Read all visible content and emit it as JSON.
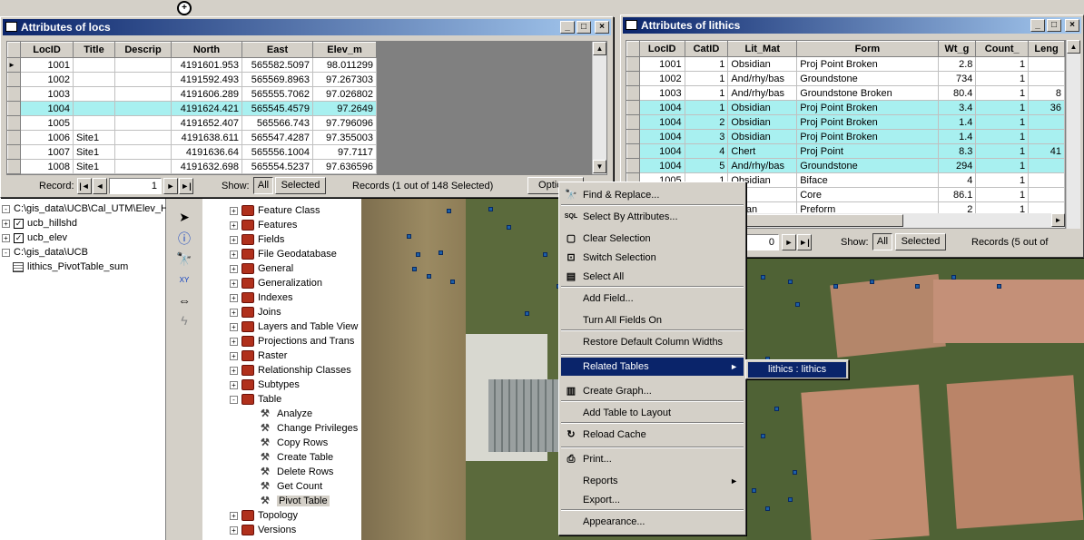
{
  "locs_window": {
    "title": "Attributes of locs",
    "columns": [
      "LocID",
      "Title",
      "Descrip",
      "North",
      "East",
      "Elev_m"
    ],
    "rows": [
      {
        "LocID": "1001",
        "Title": "",
        "Descrip": "",
        "North": "4191601.953",
        "East": "565582.5097",
        "Elev_m": "98.011299",
        "hl": false
      },
      {
        "LocID": "1002",
        "Title": "",
        "Descrip": "",
        "North": "4191592.493",
        "East": "565569.8963",
        "Elev_m": "97.267303",
        "hl": false
      },
      {
        "LocID": "1003",
        "Title": "",
        "Descrip": "",
        "North": "4191606.289",
        "East": "565555.7062",
        "Elev_m": "97.026802",
        "hl": false
      },
      {
        "LocID": "1004",
        "Title": "",
        "Descrip": "",
        "North": "4191624.421",
        "East": "565545.4579",
        "Elev_m": "97.2649",
        "hl": true
      },
      {
        "LocID": "1005",
        "Title": "",
        "Descrip": "",
        "North": "4191652.407",
        "East": "565566.743",
        "Elev_m": "97.796096",
        "hl": false
      },
      {
        "LocID": "1006",
        "Title": "Site1",
        "Descrip": "",
        "North": "4191638.611",
        "East": "565547.4287",
        "Elev_m": "97.355003",
        "hl": false
      },
      {
        "LocID": "1007",
        "Title": "Site1",
        "Descrip": "",
        "North": "4191636.64",
        "East": "565556.1004",
        "Elev_m": "97.7117",
        "hl": false
      },
      {
        "LocID": "1008",
        "Title": "Site1",
        "Descrip": "",
        "North": "4191632.698",
        "East": "565554.5237",
        "Elev_m": "97.636596",
        "hl": false
      }
    ],
    "record_label": "Record:",
    "record_value": "1",
    "show_label": "Show:",
    "show_all": "All",
    "show_selected": "Selected",
    "records_status": "Records (1 out of 148 Selected)",
    "options_label": "Options"
  },
  "lithics_window": {
    "title": "Attributes of lithics",
    "columns": [
      "LocID",
      "CatID",
      "Lit_Mat",
      "Form",
      "Wt_g",
      "Count_",
      "Leng"
    ],
    "rows": [
      {
        "LocID": "1001",
        "CatID": "1",
        "Lit_Mat": "Obsidian",
        "Form": "Proj Point Broken",
        "Wt_g": "2.8",
        "Count_": "1",
        "Leng": "",
        "hl": false
      },
      {
        "LocID": "1002",
        "CatID": "1",
        "Lit_Mat": "And/rhy/bas",
        "Form": "Groundstone",
        "Wt_g": "734",
        "Count_": "1",
        "Leng": "",
        "hl": false
      },
      {
        "LocID": "1003",
        "CatID": "1",
        "Lit_Mat": "And/rhy/bas",
        "Form": "Groundstone Broken",
        "Wt_g": "80.4",
        "Count_": "1",
        "Leng": "8",
        "hl": false
      },
      {
        "LocID": "1004",
        "CatID": "1",
        "Lit_Mat": "Obsidian",
        "Form": "Proj Point Broken",
        "Wt_g": "3.4",
        "Count_": "1",
        "Leng": "36",
        "hl": true
      },
      {
        "LocID": "1004",
        "CatID": "2",
        "Lit_Mat": "Obsidian",
        "Form": "Proj Point Broken",
        "Wt_g": "1.4",
        "Count_": "1",
        "Leng": "",
        "hl": true
      },
      {
        "LocID": "1004",
        "CatID": "3",
        "Lit_Mat": "Obsidian",
        "Form": "Proj Point Broken",
        "Wt_g": "1.4",
        "Count_": "1",
        "Leng": "",
        "hl": true
      },
      {
        "LocID": "1004",
        "CatID": "4",
        "Lit_Mat": "Chert",
        "Form": "Proj Point",
        "Wt_g": "8.3",
        "Count_": "1",
        "Leng": "41",
        "hl": true
      },
      {
        "LocID": "1004",
        "CatID": "5",
        "Lit_Mat": "And/rhy/bas",
        "Form": "Groundstone",
        "Wt_g": "294",
        "Count_": "1",
        "Leng": "",
        "hl": true
      },
      {
        "LocID": "1005",
        "CatID": "1",
        "Lit_Mat": "Obsidian",
        "Form": "Biface",
        "Wt_g": "4",
        "Count_": "1",
        "Leng": "",
        "hl": false
      },
      {
        "LocID": "",
        "CatID": "",
        "Lit_Mat": "ert",
        "Form": "Core",
        "Wt_g": "86.1",
        "Count_": "1",
        "Leng": "",
        "hl": false
      },
      {
        "LocID": "",
        "CatID": "",
        "Lit_Mat": "sidian",
        "Form": "Preform",
        "Wt_g": "2",
        "Count_": "1",
        "Leng": "",
        "hl": false
      }
    ],
    "record_value": "0",
    "show_label": "Show:",
    "show_all": "All",
    "show_selected": "Selected",
    "records_status": "Records (5 out of"
  },
  "context_menu": {
    "items": [
      {
        "label": "Find & Replace...",
        "icon": "binoculars-icon"
      },
      {
        "label": "Select By Attributes...",
        "icon": "sql-icon"
      },
      {
        "label": "Clear Selection",
        "icon": "clear-selection-icon"
      },
      {
        "label": "Switch Selection",
        "icon": "switch-selection-icon"
      },
      {
        "label": "Select All",
        "icon": "select-all-icon"
      },
      {
        "label": "Add Field...",
        "icon": ""
      },
      {
        "label": "Turn All Fields On",
        "icon": ""
      },
      {
        "label": "Restore Default Column Widths",
        "icon": ""
      },
      {
        "label": "Related Tables",
        "icon": ""
      },
      {
        "label": "Create Graph...",
        "icon": "graph-icon"
      },
      {
        "label": "Add Table to Layout",
        "icon": ""
      },
      {
        "label": "Reload Cache",
        "icon": "reload-icon"
      },
      {
        "label": "Print...",
        "icon": "printer-icon"
      },
      {
        "label": "Reports",
        "icon": ""
      },
      {
        "label": "Export...",
        "icon": ""
      },
      {
        "label": "Appearance...",
        "icon": ""
      }
    ],
    "submenu_item": "lithics : lithics"
  },
  "toc": {
    "items": [
      {
        "label": "C:\\gis_data\\UCB\\Cal_UTM\\Elev_Hi"
      },
      {
        "label": "ucb_hillshd"
      },
      {
        "label": "ucb_elev"
      },
      {
        "label": "C:\\gis_data\\UCB"
      },
      {
        "label": "lithics_PivotTable_sum"
      }
    ]
  },
  "toolbox": {
    "items": [
      "Feature Class",
      "Features",
      "Fields",
      "File Geodatabase",
      "General",
      "Generalization",
      "Indexes",
      "Joins",
      "Layers and Table View",
      "Projections and Trans",
      "Raster",
      "Relationship Classes",
      "Subtypes",
      "Table"
    ],
    "table_tools": [
      "Analyze",
      "Change Privileges",
      "Copy Rows",
      "Create Table",
      "Delete Rows",
      "Get Count",
      "Pivot Table"
    ],
    "after": [
      "Topology",
      "Versions"
    ]
  },
  "colors": {
    "highlight": "#a8f0f0",
    "titlebar": "#0a246a",
    "menu_active": "#0a246a"
  }
}
